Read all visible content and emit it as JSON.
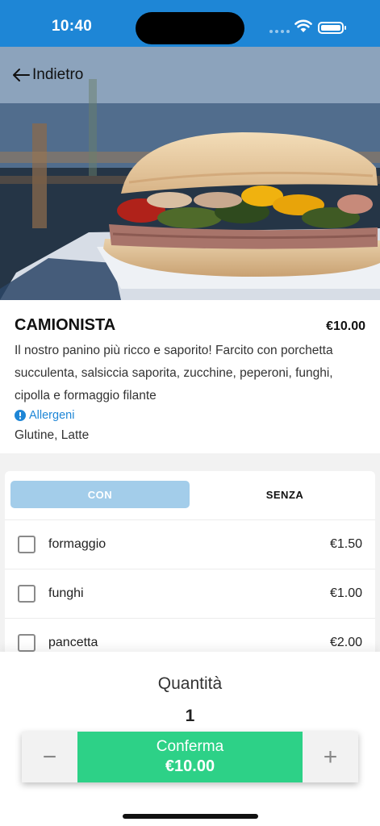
{
  "status_bar": {
    "time": "10:40"
  },
  "nav": {
    "back_label": "Indietro"
  },
  "product": {
    "name": "CAMIONISTA",
    "price": "€10.00",
    "description": "Il nostro panino più ricco e saporito! Farcito con porchetta succulenta, salsiccia saporita, zucchine, peperoni, funghi, cipolla e formaggio filante",
    "allergens_link": "Allergeni",
    "allergens": "Glutine, Latte"
  },
  "tabs": {
    "with_label": "CON",
    "without_label": "SENZA",
    "selected": "CON"
  },
  "options": [
    {
      "name": "formaggio",
      "price": "€1.50",
      "checked": false
    },
    {
      "name": "funghi",
      "price": "€1.00",
      "checked": false
    },
    {
      "name": "pancetta",
      "price": "€2.00",
      "checked": false
    }
  ],
  "quantity": {
    "label": "Quantità",
    "value": "1"
  },
  "actions": {
    "confirm_label": "Conferma",
    "confirm_total": "€10.00",
    "minus_symbol": "−",
    "plus_symbol": "+"
  },
  "colors": {
    "header": "#1e86d6",
    "tab_selected": "#a3cdea",
    "confirm": "#2dd187",
    "link": "#1e86d6"
  }
}
